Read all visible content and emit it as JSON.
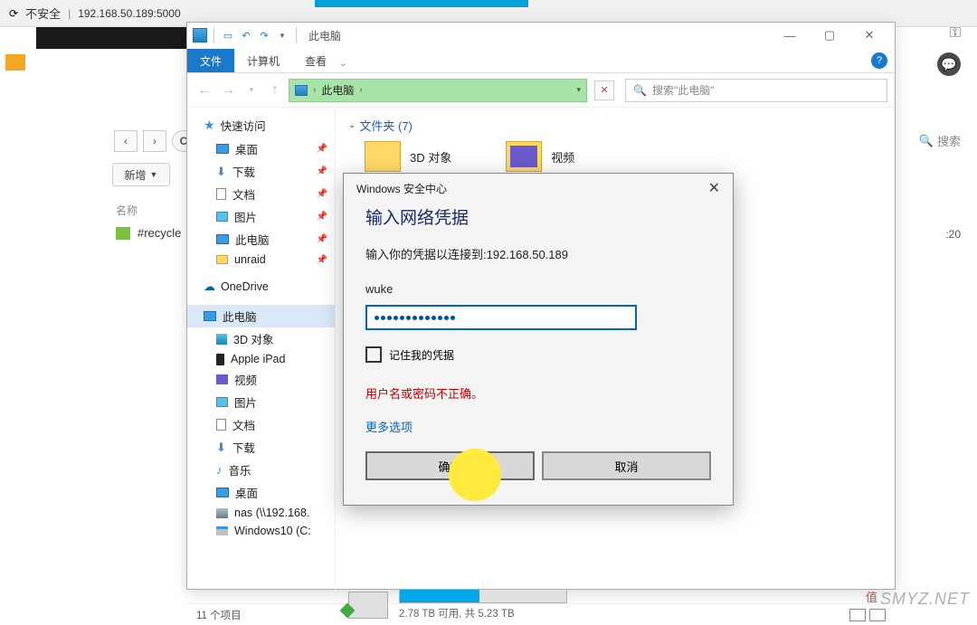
{
  "browser": {
    "insecure": "不安全",
    "url": "192.168.50.189:5000"
  },
  "explorer": {
    "title": "此电脑",
    "ribbon": {
      "file": "文件",
      "computer": "计算机",
      "view": "查看"
    },
    "address": {
      "label": "此电脑",
      "sep": "›"
    },
    "search_placeholder": "搜索\"此电脑\"",
    "section": "文件夹 (7)",
    "folders": {
      "f3d": "3D 对象",
      "video": "视频"
    },
    "drive": {
      "free": "2.78 TB 可用, 共 5.23 TB"
    },
    "status": "11 个项目"
  },
  "sidebar": {
    "quick": "快速访问",
    "desktop": "桌面",
    "downloads": "下载",
    "docs": "文档",
    "pics": "图片",
    "thispc": "此电脑",
    "unraid": "unraid",
    "onedrive": "OneDrive",
    "thispc2": "此电脑",
    "obj3d": "3D 对象",
    "ipad": "Apple iPad",
    "video": "视频",
    "pics2": "图片",
    "docs2": "文档",
    "dl2": "下载",
    "music": "音乐",
    "desk2": "桌面",
    "nas": "nas (\\\\192.168.",
    "win": "Windows10 (C:"
  },
  "cred": {
    "window_title": "Windows 安全中心",
    "heading": "输入网络凭据",
    "subtitle": "输入你的凭据以连接到:192.168.50.189",
    "username": "wuke",
    "remember": "记住我的凭据",
    "error": "用户名或密码不正确。",
    "more": "更多选项",
    "ok": "确定",
    "cancel": "取消"
  },
  "bg": {
    "new": "新增",
    "name_hdr": "名称",
    "recycle": "#recycle",
    "time": ":20",
    "search": "搜索"
  },
  "wm": {
    "smyz": "SMYZ.NET",
    "zh": "值"
  }
}
